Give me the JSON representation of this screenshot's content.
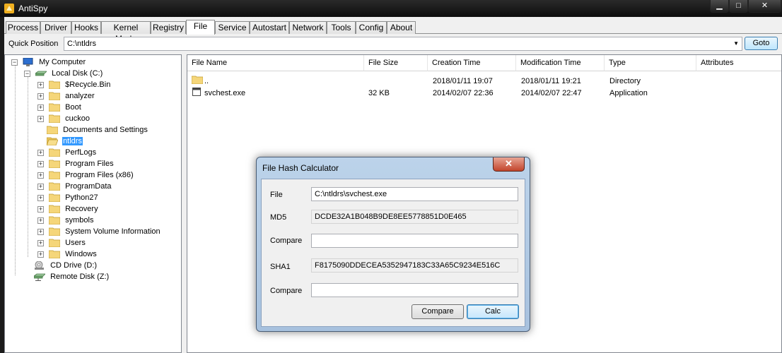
{
  "app": {
    "title": "AntiSpy",
    "min_glyph": "▁",
    "max_glyph": "□",
    "close_glyph": "✕"
  },
  "tabs": [
    {
      "label": "Process"
    },
    {
      "label": "Driver"
    },
    {
      "label": "Hooks"
    },
    {
      "label": "Kernel Mode"
    },
    {
      "label": "Registry"
    },
    {
      "label": "File",
      "active": true
    },
    {
      "label": "Service"
    },
    {
      "label": "Autostart"
    },
    {
      "label": "Network"
    },
    {
      "label": "Tools"
    },
    {
      "label": "Config"
    },
    {
      "label": "About"
    }
  ],
  "quick_position": {
    "label": "Quick Position",
    "value": "C:\\ntldrs",
    "goto_label": "Goto"
  },
  "tree": {
    "root": "My Computer",
    "local_disk": "Local Disk (C:)",
    "folders": [
      {
        "name": "$Recycle.Bin",
        "expandable": true
      },
      {
        "name": "analyzer",
        "expandable": true
      },
      {
        "name": "Boot",
        "expandable": true
      },
      {
        "name": "cuckoo",
        "expandable": true
      },
      {
        "name": "Documents and Settings",
        "expandable": false
      },
      {
        "name": "ntldrs",
        "expandable": false,
        "selected": true
      },
      {
        "name": "PerfLogs",
        "expandable": true
      },
      {
        "name": "Program Files",
        "expandable": true
      },
      {
        "name": "Program Files (x86)",
        "expandable": true
      },
      {
        "name": "ProgramData",
        "expandable": true
      },
      {
        "name": "Python27",
        "expandable": true
      },
      {
        "name": "Recovery",
        "expandable": true
      },
      {
        "name": "symbols",
        "expandable": true
      },
      {
        "name": "System Volume Information",
        "expandable": true
      },
      {
        "name": "Users",
        "expandable": true
      },
      {
        "name": "Windows",
        "expandable": true
      }
    ],
    "cd_drive": "CD Drive (D:)",
    "remote_disk": "Remote Disk (Z:)"
  },
  "file_list": {
    "columns": [
      "File Name",
      "File Size",
      "Creation Time",
      "Modification Time",
      "Type",
      "Attributes"
    ],
    "rows": [
      {
        "name": "..",
        "size": "",
        "created": "2018/01/11 19:07",
        "modified": "2018/01/11 19:21",
        "type": "Directory",
        "attributes": "",
        "icon": "folder-icon"
      },
      {
        "name": "svchest.exe",
        "size": "32 KB",
        "created": "2014/02/07 22:36",
        "modified": "2014/02/07 22:47",
        "type": "Application",
        "attributes": "",
        "icon": "exe-file-icon"
      }
    ]
  },
  "dialog": {
    "title": "File Hash Calculator",
    "close_glyph": "✕",
    "file_label": "File",
    "file_value": "C:\\ntldrs\\svchest.exe",
    "md5_label": "MD5",
    "md5_value": "DCDE32A1B048B9DE8EE5778851D0E465",
    "compare1_label": "Compare",
    "compare1_value": "",
    "sha1_label": "SHA1",
    "sha1_value": "F8175090DDECEA5352947183C33A65C9234E516C",
    "compare2_label": "Compare",
    "compare2_value": "",
    "compare_button": "Compare",
    "calc_button": "Calc"
  }
}
